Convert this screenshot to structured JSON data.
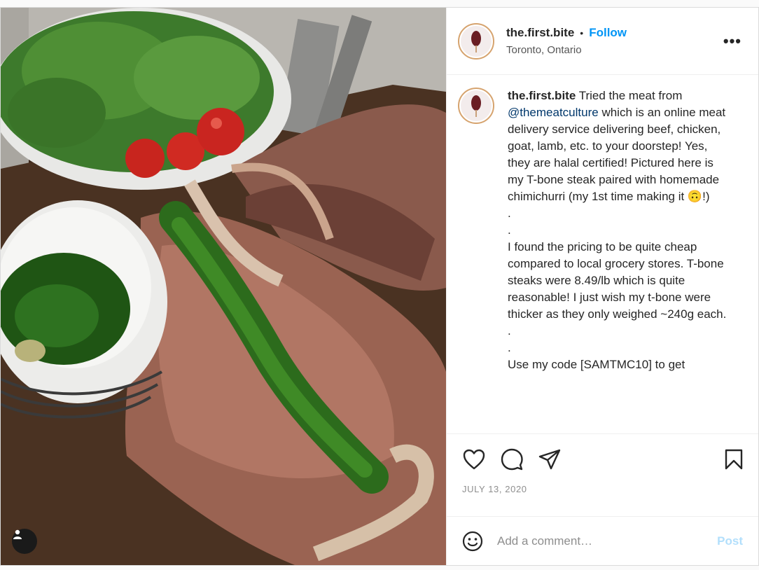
{
  "header": {
    "username": "the.first.bite",
    "separator": "•",
    "follow_label": "Follow",
    "location": "Toronto, Ontario",
    "more_label": "•••"
  },
  "caption": {
    "username": "the.first.bite",
    "lines": [
      {
        "pre": " Tried the meat from ",
        "mention": "@themeatculture",
        "post": " which is an online meat delivery service delivering beef, chicken, goat, lamb, etc. to your doorstep! Yes, they are halal certified! Pictured here is my T-bone steak paired with homemade chimichurri (my 1st time making it 🙃!)"
      }
    ],
    "paragraph_2": "I found the pricing to be quite cheap compared to local grocery stores. T-bone steaks were 8.49/lb which is quite reasonable! I just wish my t-bone were thicker as they only weighed ~240g each.",
    "paragraph_3": "Use my code [SAMTMC10] to get",
    "dot_line": "."
  },
  "actions": {
    "like_icon": "heart-icon",
    "comment_icon": "comment-icon",
    "share_icon": "share-icon",
    "save_icon": "bookmark-icon"
  },
  "date": "JULY 13, 2020",
  "comment": {
    "placeholder": "Add a comment…",
    "post_label": "Post",
    "emoji_icon": "smiley-icon"
  },
  "colors": {
    "follow_blue": "#0095f6",
    "post_disabled": "#b2dffc",
    "mention": "#00376b"
  }
}
